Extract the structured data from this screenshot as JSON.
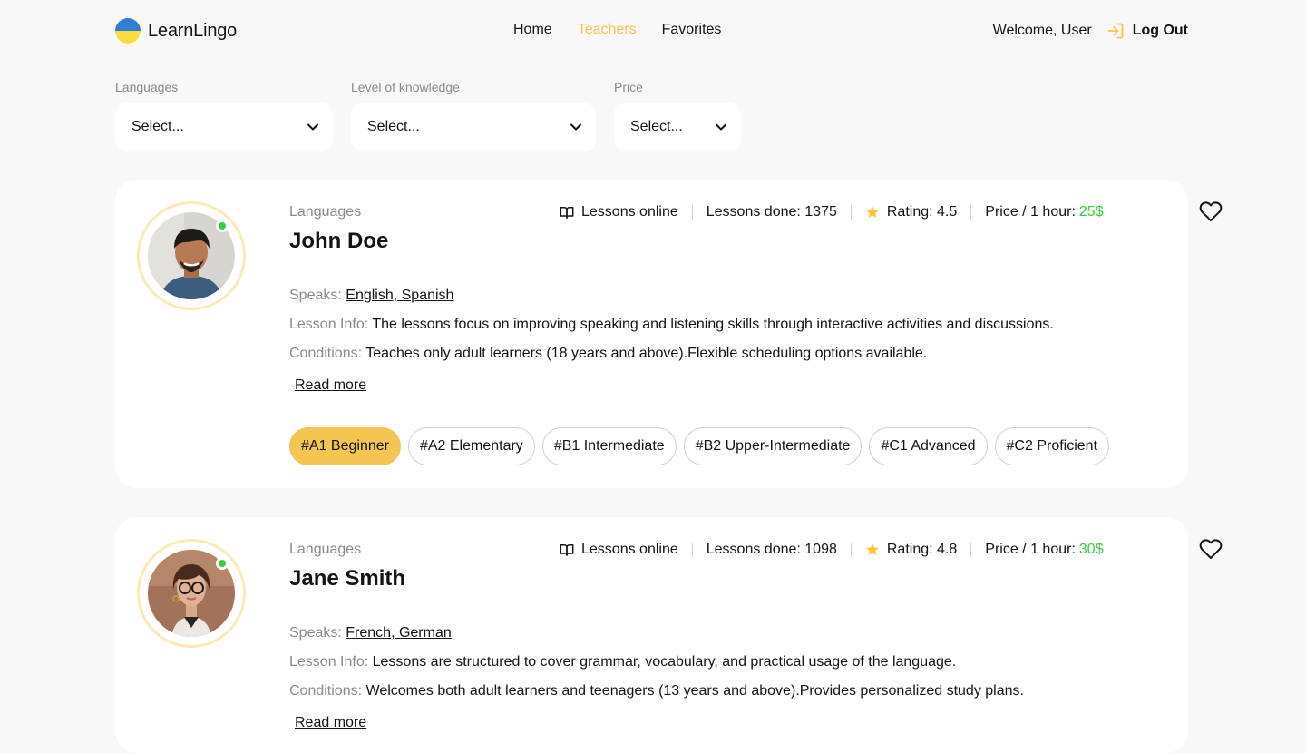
{
  "brand": {
    "name": "LearnLingo"
  },
  "nav": {
    "items": [
      "Home",
      "Teachers",
      "Favorites"
    ],
    "active": "Teachers"
  },
  "user": {
    "welcome": "Welcome, User",
    "logout_label": "Log Out"
  },
  "filters": [
    {
      "label": "Languages",
      "value": "Select..."
    },
    {
      "label": "Level of knowledge",
      "value": "Select..."
    },
    {
      "label": "Price",
      "value": "Select..."
    }
  ],
  "teachers": [
    {
      "kind": "Languages",
      "name": "John Doe",
      "lessons_online": "Lessons online",
      "lessons_done_label": "Lessons done:",
      "lessons_done": "1375",
      "rating_label": "Rating:",
      "rating": "4.5",
      "price_label": "Price / 1 hour:",
      "price": "25$",
      "speaks_label": "Speaks:",
      "speaks": "English, Spanish",
      "lesson_info_label": "Lesson Info:",
      "lesson_info": "The lessons focus on improving speaking and listening skills through interactive activities and discussions.",
      "conditions_label": "Conditions:",
      "conditions": "Teaches only adult learners (18 years and above).Flexible scheduling options available.",
      "read_more": "Read more",
      "levels": [
        "#A1 Beginner",
        "#A2 Elementary",
        "#B1 Intermediate",
        "#B2 Upper-Intermediate",
        "#C1 Advanced",
        "#C2 Proficient"
      ],
      "active_level": "#A1 Beginner"
    },
    {
      "kind": "Languages",
      "name": "Jane Smith",
      "lessons_online": "Lessons online",
      "lessons_done_label": "Lessons done:",
      "lessons_done": "1098",
      "rating_label": "Rating:",
      "rating": "4.8",
      "price_label": "Price / 1 hour:",
      "price": "30$",
      "speaks_label": "Speaks:",
      "speaks": "French, German",
      "lesson_info_label": "Lesson Info:",
      "lesson_info": "Lessons are structured to cover grammar, vocabulary, and practical usage of the language.",
      "conditions_label": "Conditions:",
      "conditions": "Welcomes both adult learners and teenagers (13 years and above).Provides personalized study plans.",
      "read_more": "Read more"
    }
  ],
  "colors": {
    "accent": "#f4c550",
    "price": "#38cd3e",
    "online": "#38cd3e",
    "ring": "#fbe9ba",
    "background": "#f8f8f8"
  },
  "icons": [
    "book-open-icon",
    "star-icon",
    "heart-icon",
    "log-in-icon",
    "chevron-down-icon"
  ]
}
